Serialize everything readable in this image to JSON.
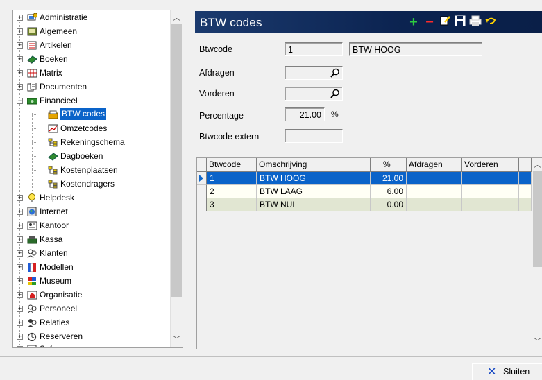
{
  "tree": {
    "nodes": [
      {
        "label": "Administratie",
        "icon": "administration-icon",
        "expander": "+"
      },
      {
        "label": "Algemeen",
        "icon": "general-icon",
        "expander": "+"
      },
      {
        "label": "Artikelen",
        "icon": "articles-icon",
        "expander": "+"
      },
      {
        "label": "Boeken",
        "icon": "books-icon",
        "expander": "+"
      },
      {
        "label": "Matrix",
        "icon": "matrix-icon",
        "expander": "+"
      },
      {
        "label": "Documenten",
        "icon": "documents-icon",
        "expander": "+"
      },
      {
        "label": "Financieel",
        "icon": "financial-icon",
        "expander": "−"
      },
      {
        "label": "BTW codes",
        "icon": "vat-codes-icon",
        "selected": true
      },
      {
        "label": "Omzetcodes",
        "icon": "revenue-codes-icon"
      },
      {
        "label": "Rekeningschema",
        "icon": "chart-of-accounts-icon"
      },
      {
        "label": "Dagboeken",
        "icon": "journals-icon"
      },
      {
        "label": "Kostenplaatsen",
        "icon": "cost-centers-icon"
      },
      {
        "label": "Kostendragers",
        "icon": "cost-carriers-icon"
      },
      {
        "label": "Helpdesk",
        "icon": "helpdesk-icon",
        "expander": "+"
      },
      {
        "label": "Internet",
        "icon": "internet-icon",
        "expander": "+"
      },
      {
        "label": "Kantoor",
        "icon": "office-icon",
        "expander": "+"
      },
      {
        "label": "Kassa",
        "icon": "cash-register-icon",
        "expander": "+"
      },
      {
        "label": "Klanten",
        "icon": "customers-icon",
        "expander": "+"
      },
      {
        "label": "Modellen",
        "icon": "models-icon",
        "expander": "+"
      },
      {
        "label": "Museum",
        "icon": "museum-icon",
        "expander": "+"
      },
      {
        "label": "Organisatie",
        "icon": "organization-icon",
        "expander": "+"
      },
      {
        "label": "Personeel",
        "icon": "staff-icon",
        "expander": "+"
      },
      {
        "label": "Relaties",
        "icon": "relations-icon",
        "expander": "+"
      },
      {
        "label": "Reserveren",
        "icon": "reservations-icon",
        "expander": "+"
      },
      {
        "label": "Software",
        "icon": "software-icon",
        "expander": "+"
      }
    ]
  },
  "header": {
    "title": "BTW codes",
    "toolbar": {
      "add_icon": "plus-icon",
      "delete_icon": "minus-icon",
      "edit_icon": "edit-icon",
      "save_icon": "save-icon",
      "print_icon": "print-icon",
      "undo_icon": "undo-icon"
    }
  },
  "form": {
    "btwcode_label": "Btwcode",
    "btwcode_value": "1",
    "btwcode_name": "BTW HOOG",
    "afdragen_label": "Afdragen",
    "afdragen_value": "",
    "vorderen_label": "Vorderen",
    "vorderen_value": "",
    "percentage_label": "Percentage",
    "percentage_value": "21.00",
    "percentage_unit": "%",
    "extern_label": "Btwcode extern",
    "extern_value": ""
  },
  "grid": {
    "columns": [
      "Btwcode",
      "Omschrijving",
      "%",
      "Afdragen",
      "Vorderen"
    ],
    "rows": [
      {
        "code": "1",
        "desc": "BTW HOOG",
        "pct": "21.00",
        "afdragen": "",
        "vorderen": "",
        "selected": true
      },
      {
        "code": "2",
        "desc": "BTW LAAG",
        "pct": "6.00",
        "afdragen": "",
        "vorderen": ""
      },
      {
        "code": "3",
        "desc": "BTW NUL",
        "pct": "0.00",
        "afdragen": "",
        "vorderen": ""
      }
    ]
  },
  "footer": {
    "close_label": "Sluiten",
    "close_icon": "close-icon"
  },
  "colors": {
    "selection": "#0a63c9",
    "header_bg": "#0b2350",
    "row_even": "#fffff5",
    "row_odd": "#e1e6d2"
  }
}
